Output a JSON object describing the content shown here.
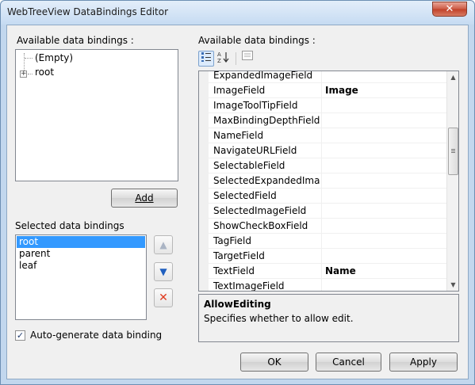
{
  "window": {
    "title": "WebTreeView DataBindings Editor",
    "close_glyph": "✕"
  },
  "left": {
    "available_label": "Available data bindings :",
    "tree": [
      {
        "label": "(Empty)"
      },
      {
        "label": "root",
        "expander": "+"
      }
    ],
    "add_button": "Add",
    "selected_label": "Selected data bindings",
    "selected_items": [
      {
        "label": "root",
        "selected": true
      },
      {
        "label": "parent",
        "selected": false
      },
      {
        "label": "leaf",
        "selected": false
      }
    ],
    "move_up_glyph": "▲",
    "move_down_glyph": "▼",
    "delete_glyph": "✕",
    "auto_generate_label": "Auto-generate  data binding",
    "auto_generate_checked": true,
    "checkbox_glyph": "✓"
  },
  "right": {
    "available_label": "Available data bindings :",
    "toolbar": {
      "categorized_icon": "categorized-icon",
      "alphabetical_icon": "alphabetical-sort-icon",
      "property_pages_icon": "property-pages-icon"
    },
    "properties": [
      {
        "name": "ExpandedImageField",
        "value": ""
      },
      {
        "name": "ImageField",
        "value": "Image"
      },
      {
        "name": "ImageToolTipField",
        "value": ""
      },
      {
        "name": "MaxBindingDepthField",
        "value": ""
      },
      {
        "name": "NameField",
        "value": ""
      },
      {
        "name": "NavigateURLField",
        "value": ""
      },
      {
        "name": "SelectableField",
        "value": ""
      },
      {
        "name": "SelectedExpandedImageF",
        "value": ""
      },
      {
        "name": "SelectedField",
        "value": ""
      },
      {
        "name": "SelectedImageField",
        "value": ""
      },
      {
        "name": "ShowCheckBoxField",
        "value": ""
      },
      {
        "name": "TagField",
        "value": ""
      },
      {
        "name": "TargetField",
        "value": ""
      },
      {
        "name": "TextField",
        "value": "Name"
      },
      {
        "name": "TextImageField",
        "value": ""
      }
    ],
    "description": {
      "title": "AllowEditing",
      "text": "Specifies whether to allow edit."
    }
  },
  "footer": {
    "ok": "OK",
    "cancel": "Cancel",
    "apply": "Apply"
  }
}
